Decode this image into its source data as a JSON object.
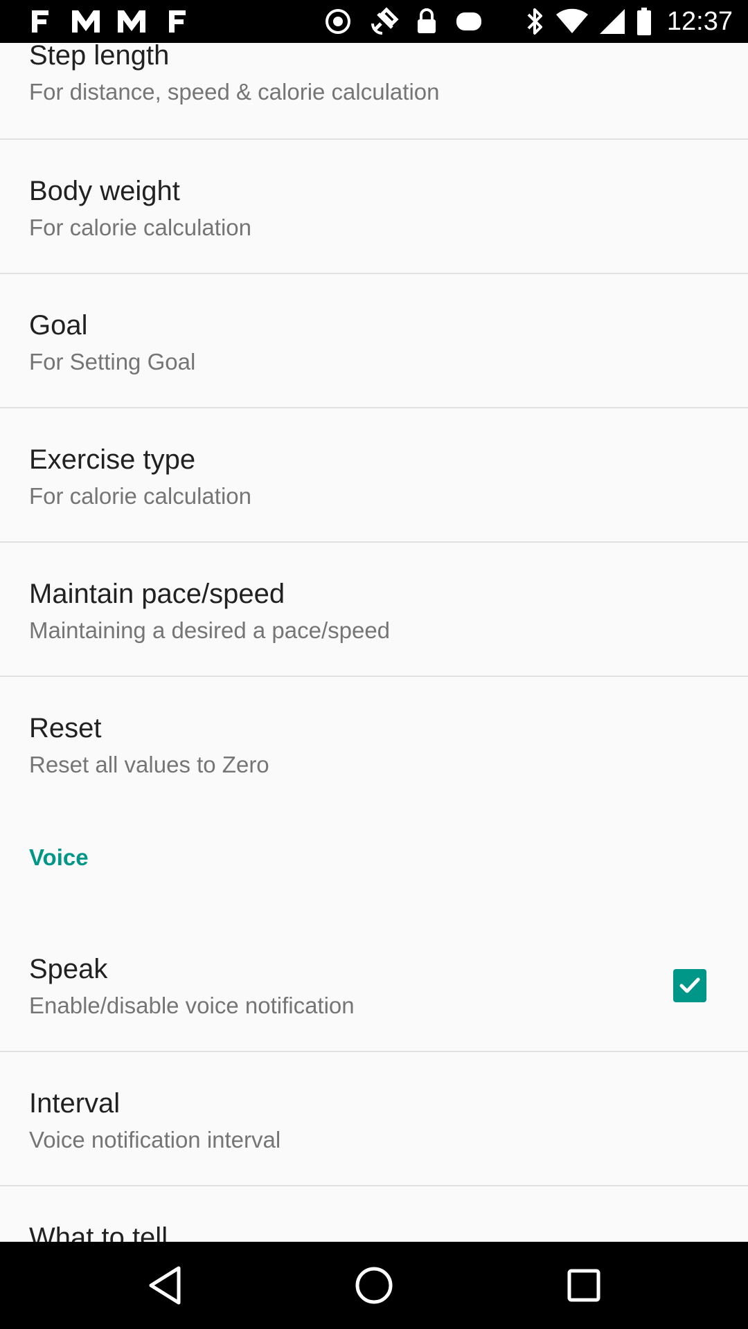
{
  "status_bar": {
    "time": "12:37",
    "icons": [
      "f-icon",
      "m-icon",
      "m-icon",
      "f-icon",
      "radio-icon",
      "fake-gps-icon",
      "lock-icon",
      "controller-icon",
      "bluetooth-icon",
      "wifi-icon",
      "signal-icon",
      "battery-icon"
    ]
  },
  "settings": {
    "items": [
      {
        "title": "Step length",
        "summary": "For distance, speed & calorie calculation"
      },
      {
        "title": "Body weight",
        "summary": "For calorie calculation"
      },
      {
        "title": "Goal",
        "summary": "For Setting Goal"
      },
      {
        "title": "Exercise type",
        "summary": "For calorie calculation"
      },
      {
        "title": "Maintain pace/speed",
        "summary": "Maintaining a desired a pace/speed"
      },
      {
        "title": "Reset",
        "summary": "Reset all values to Zero"
      }
    ],
    "voice_category": "Voice",
    "voice_items": [
      {
        "title": "Speak",
        "summary": "Enable/disable voice notification",
        "checked": true
      },
      {
        "title": "Interval",
        "summary": "Voice notification interval"
      },
      {
        "title": "What to tell",
        "summary": ""
      }
    ]
  },
  "colors": {
    "accent": "#009688",
    "background": "#fafafa"
  },
  "nav_bar": {
    "buttons": [
      "back-icon",
      "home-icon",
      "recents-icon"
    ]
  }
}
